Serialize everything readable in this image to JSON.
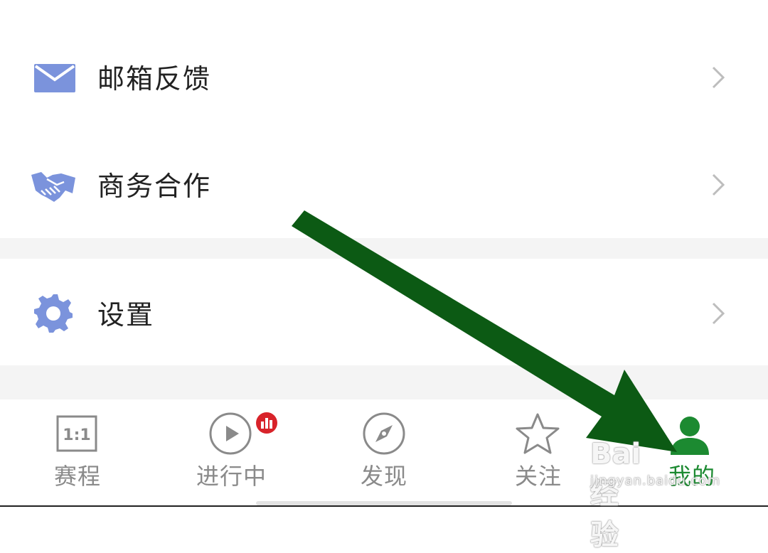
{
  "menu": {
    "items": [
      {
        "label": "邮箱反馈",
        "icon": "mail-icon"
      },
      {
        "label": "商务合作",
        "icon": "handshake-icon"
      },
      {
        "label": "设置",
        "icon": "gear-icon"
      }
    ]
  },
  "tabbar": {
    "tabs": [
      {
        "label": "赛程",
        "icon": "schedule-icon",
        "icon_text": "1:1"
      },
      {
        "label": "进行中",
        "icon": "play-icon",
        "has_badge": true
      },
      {
        "label": "发现",
        "icon": "compass-icon"
      },
      {
        "label": "关注",
        "icon": "star-icon"
      },
      {
        "label": "我的",
        "icon": "person-icon",
        "active": true
      }
    ]
  },
  "watermark": {
    "brand": "Bai 经验",
    "url": "jingyan.baidu.com"
  },
  "colors": {
    "icon_accent": "#7b93dc",
    "active_tab": "#1c8a31",
    "inactive_tab": "#8a8a8a",
    "badge": "#d8232a",
    "arrow": "#0c5a14"
  }
}
